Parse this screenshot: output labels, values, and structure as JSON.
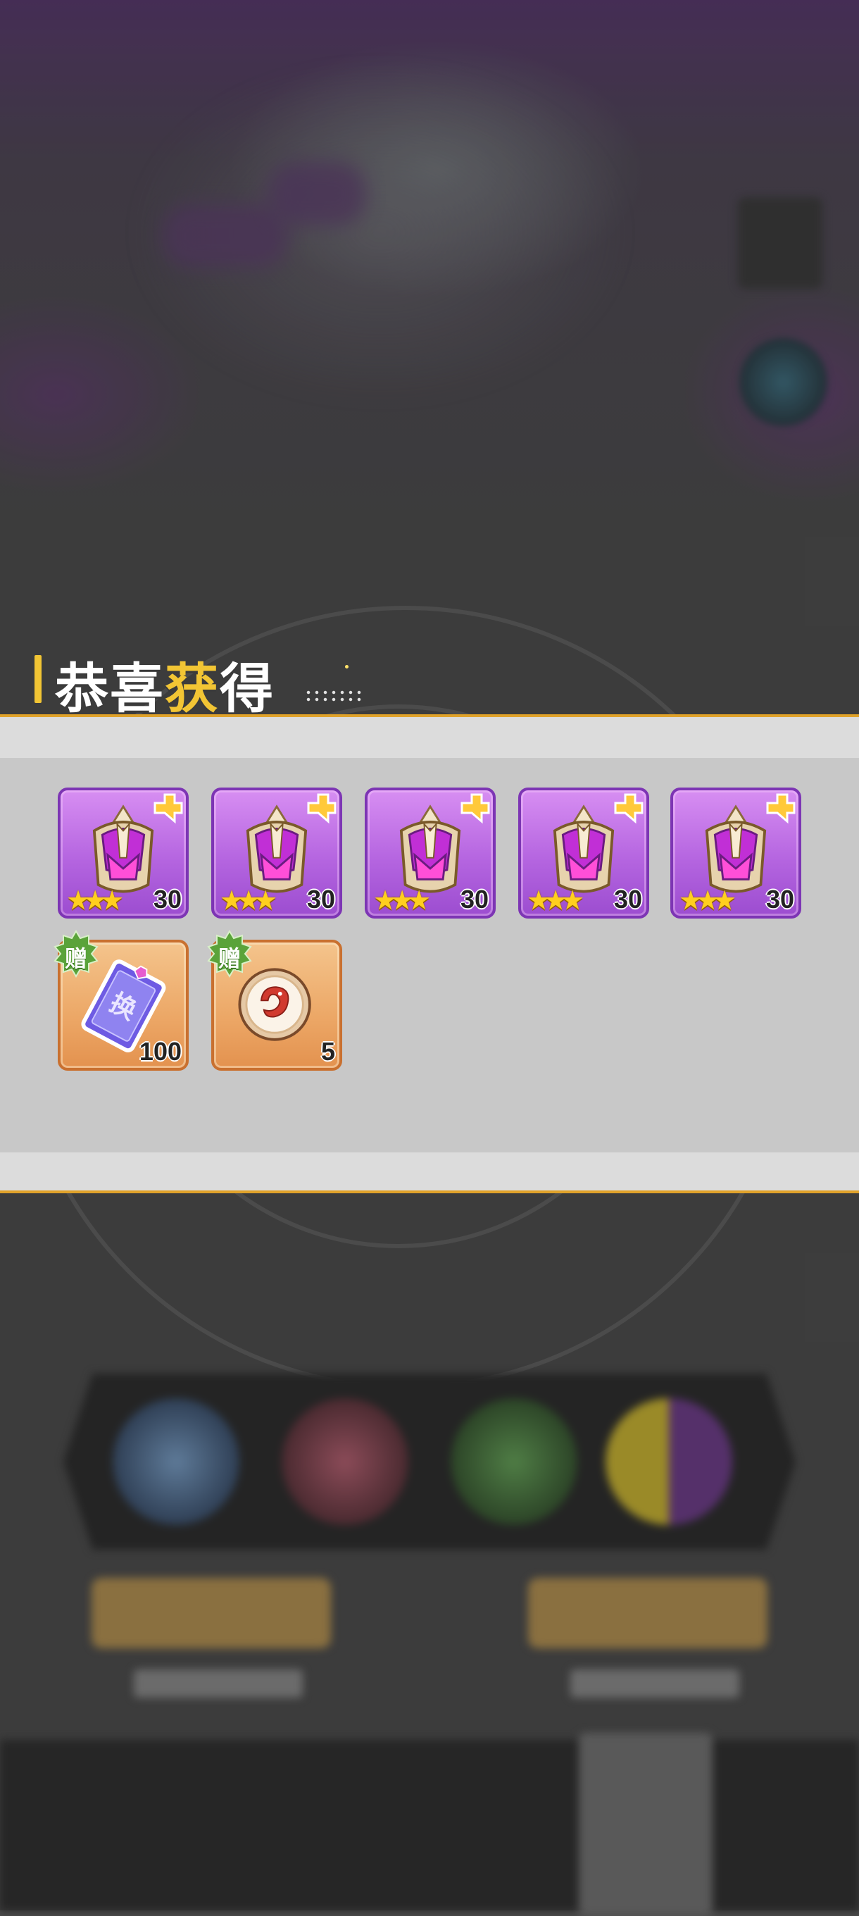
{
  "popup": {
    "title_white": "恭喜",
    "title_highlight": "获",
    "title_white2": "得"
  },
  "rewards": [
    {
      "name": "purple helmet",
      "rarity": "purple",
      "stars": 3,
      "count": "30",
      "corner": "upgrade-badge"
    },
    {
      "name": "purple helmet",
      "rarity": "purple",
      "stars": 3,
      "count": "30",
      "corner": "upgrade-badge"
    },
    {
      "name": "purple helmet",
      "rarity": "purple",
      "stars": 3,
      "count": "30",
      "corner": "upgrade-badge"
    },
    {
      "name": "purple helmet",
      "rarity": "purple",
      "stars": 3,
      "count": "30",
      "corner": "upgrade-badge"
    },
    {
      "name": "purple helmet",
      "rarity": "purple",
      "stars": 3,
      "count": "30",
      "corner": "upgrade-badge"
    },
    {
      "name": "exchange ticket",
      "rarity": "orange",
      "count": "100",
      "badge": "赠",
      "glyph": "换"
    },
    {
      "name": "dragon token",
      "rarity": "orange",
      "count": "5",
      "badge": "赠"
    }
  ],
  "colors": {
    "accent_gold": "#f2c534",
    "panel_line": "#e0a22a",
    "purple_frame": "#b565e0",
    "orange_frame": "#eca766",
    "gift_badge": "#5aa33a"
  }
}
